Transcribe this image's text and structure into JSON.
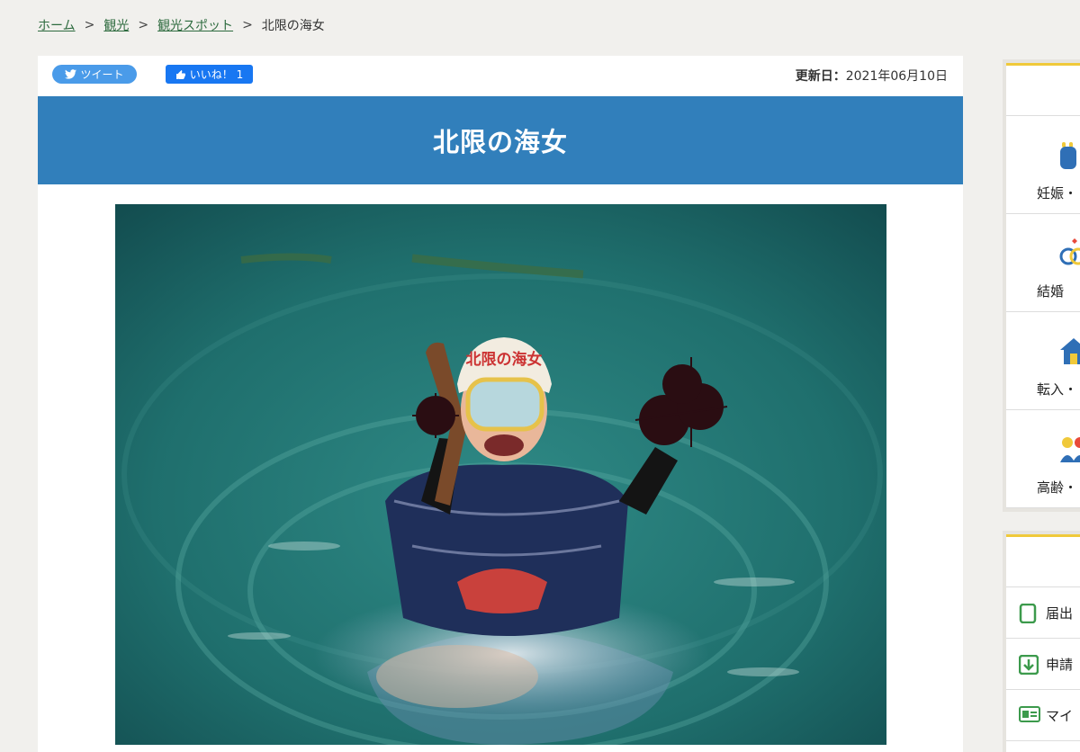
{
  "breadcrumb": {
    "home": "ホーム",
    "sep": ">",
    "level1": "観光",
    "level2": "観光スポット",
    "current": "北限の海女"
  },
  "share": {
    "tweet_label": "ツイート",
    "like_label": "いいね！ 1"
  },
  "updated": {
    "label": "更新日：",
    "date": "2021年06月10日"
  },
  "page_title": "北限の海女",
  "photo": {
    "mask_text": "北限の海女"
  },
  "sidebar_top": {
    "items": [
      {
        "label": "妊娠・",
        "icon": "baby-bottle-icon"
      },
      {
        "label": "結婚",
        "icon": "rings-icon"
      },
      {
        "label": "転入・",
        "icon": "house-icon"
      },
      {
        "label": "高齢・",
        "icon": "elderly-icon"
      }
    ]
  },
  "sidebar_bottom": {
    "links": [
      {
        "label": "届出",
        "icon": "document-icon"
      },
      {
        "label": "申請",
        "icon": "download-icon"
      },
      {
        "label": "マイ",
        "icon": "id-card-icon"
      }
    ]
  },
  "colors": {
    "title_bar": "#317fbb",
    "tweet": "#4a9be9",
    "like": "#1877f2",
    "accent_yellow": "#f0c93a",
    "link_green": "#2e6b3f"
  }
}
